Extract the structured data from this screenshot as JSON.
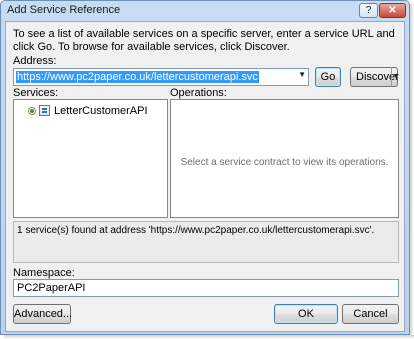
{
  "window": {
    "title": "Add Service Reference",
    "help_label": "?",
    "close_label": "✕"
  },
  "description": "To see a list of available services on a specific server, enter a service URL and click Go. To browse for available services, click Discover.",
  "address": {
    "label": "Address:",
    "value": "https://www.pc2paper.co.uk/lettercustomerapi.svc",
    "dropdown_icon": "chevron-down-icon"
  },
  "buttons": {
    "go": "Go",
    "discover": "Discover",
    "advanced": "Advanced...",
    "ok": "OK",
    "cancel": "Cancel"
  },
  "services": {
    "label": "Services:",
    "items": [
      {
        "label": "LetterCustomerAPI",
        "icon": "service-icon"
      }
    ]
  },
  "operations": {
    "label": "Operations:",
    "placeholder": "Select a service contract to view its operations."
  },
  "status": "1 service(s) found at address 'https://www.pc2paper.co.uk/lettercustomerapi.svc'.",
  "namespace": {
    "label": "Namespace:",
    "value": "PC2PaperAPI"
  }
}
